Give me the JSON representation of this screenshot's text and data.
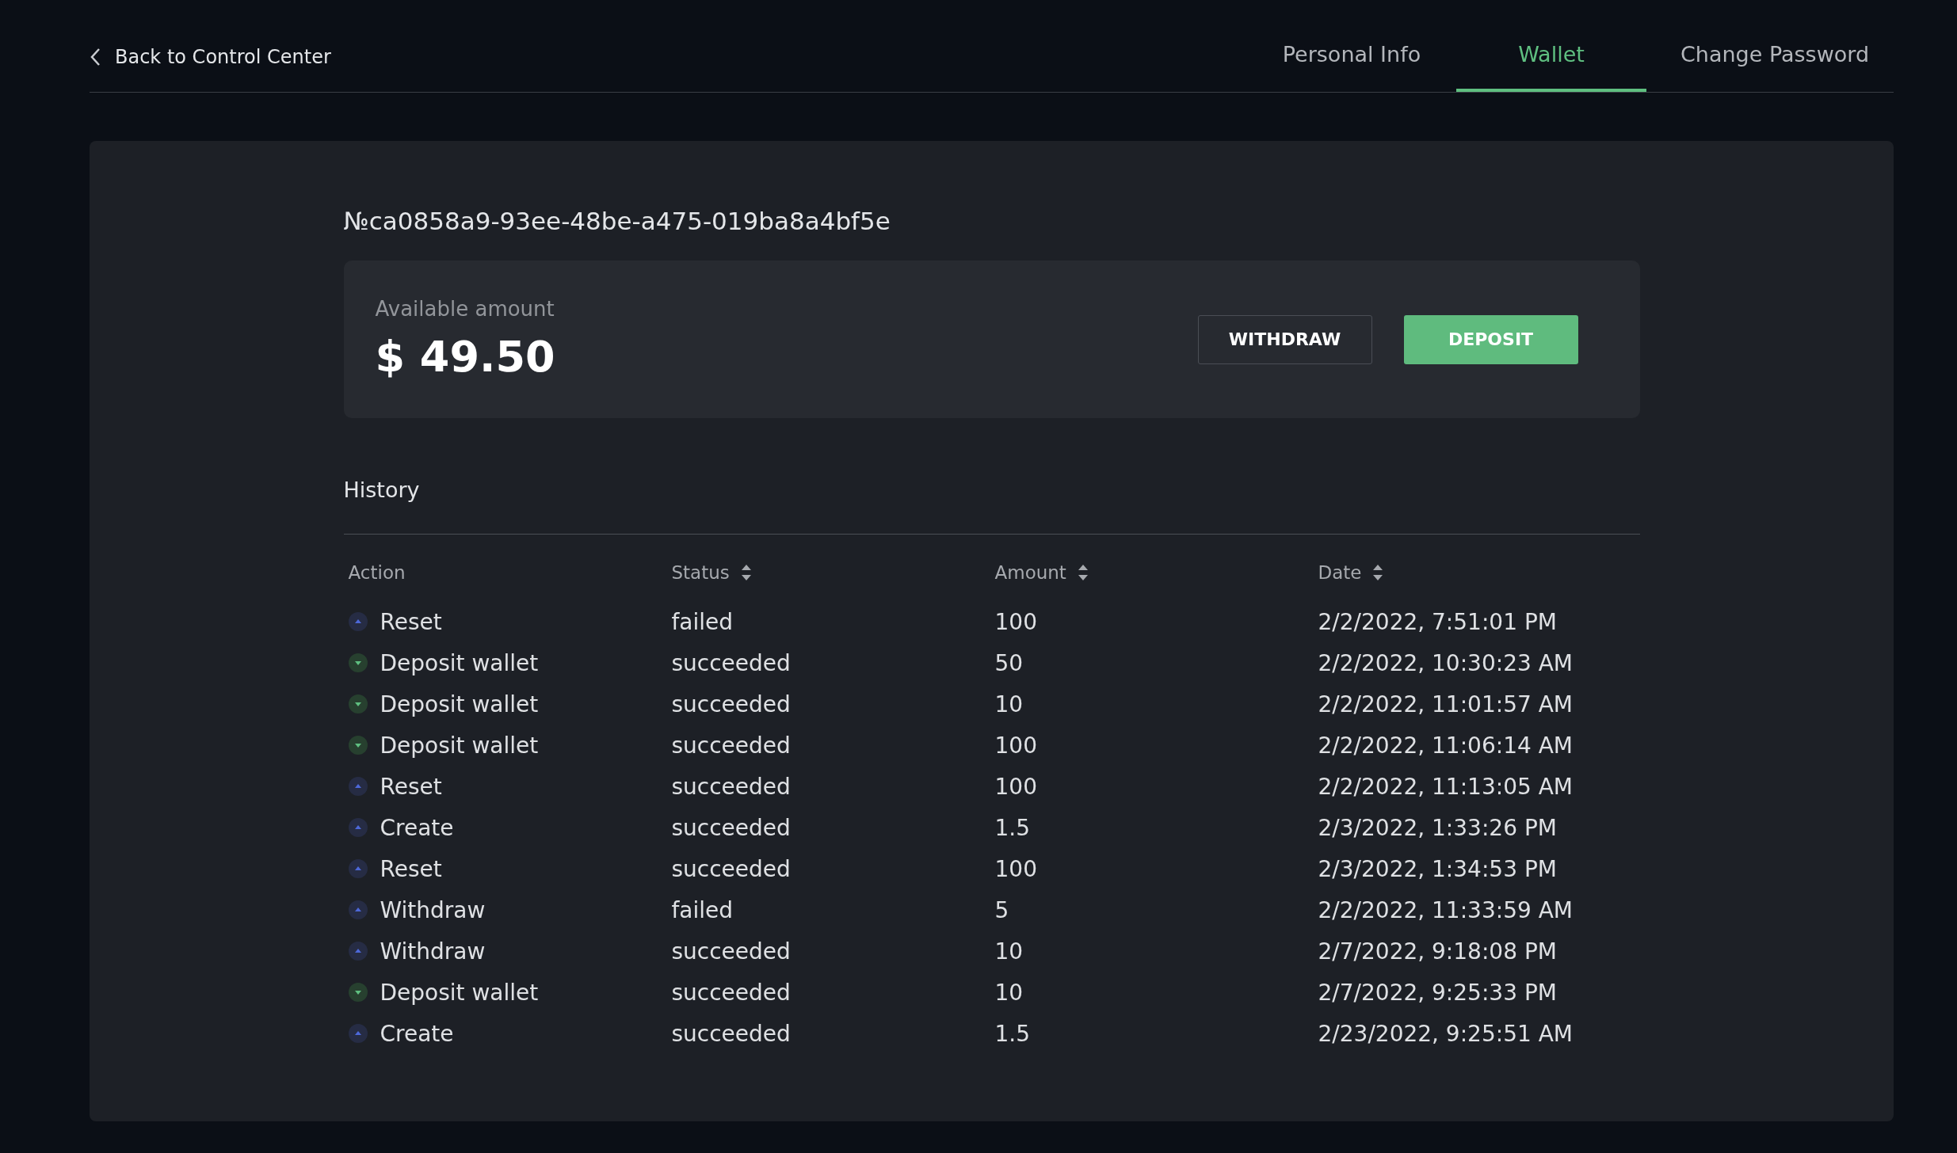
{
  "back_link": "Back to Control Center",
  "tabs": [
    {
      "label": "Personal Info",
      "selected": false
    },
    {
      "label": "Wallet",
      "selected": true
    },
    {
      "label": "Change Password",
      "selected": false
    }
  ],
  "wallet": {
    "id": "№ca0858a9-93ee-48be-a475-019ba8a4bf5e",
    "balance_label": "Available amount",
    "balance": "$ 49.50",
    "buttons": [
      {
        "label": "WITHDRAW",
        "kind": "outline"
      },
      {
        "label": "DEPOSIT",
        "kind": "primary"
      }
    ]
  },
  "history": {
    "title": "History",
    "columns": [
      {
        "label": "Action",
        "sortable": false
      },
      {
        "label": "Status",
        "sortable": true
      },
      {
        "label": "Amount",
        "sortable": true
      },
      {
        "label": "Date",
        "sortable": true
      }
    ],
    "rows": [
      {
        "kind": "outgoing",
        "action": "Reset",
        "status": "failed",
        "amount": "100",
        "date": "2/2/2022, 7:51:01 PM"
      },
      {
        "kind": "incoming",
        "action": "Deposit wallet",
        "status": "succeeded",
        "amount": "50",
        "date": "2/2/2022, 10:30:23 AM"
      },
      {
        "kind": "incoming",
        "action": "Deposit wallet",
        "status": "succeeded",
        "amount": "10",
        "date": "2/2/2022, 11:01:57 AM"
      },
      {
        "kind": "incoming",
        "action": "Deposit wallet",
        "status": "succeeded",
        "amount": "100",
        "date": "2/2/2022, 11:06:14 AM"
      },
      {
        "kind": "outgoing",
        "action": "Reset",
        "status": "succeeded",
        "amount": "100",
        "date": "2/2/2022, 11:13:05 AM"
      },
      {
        "kind": "outgoing",
        "action": "Create",
        "status": "succeeded",
        "amount": "1.5",
        "date": "2/3/2022, 1:33:26 PM"
      },
      {
        "kind": "outgoing",
        "action": "Reset",
        "status": "succeeded",
        "amount": "100",
        "date": "2/3/2022, 1:34:53 PM"
      },
      {
        "kind": "outgoing",
        "action": "Withdraw",
        "status": "failed",
        "amount": "5",
        "date": "2/2/2022, 11:33:59 AM"
      },
      {
        "kind": "outgoing",
        "action": "Withdraw",
        "status": "succeeded",
        "amount": "10",
        "date": "2/7/2022, 9:18:08 PM"
      },
      {
        "kind": "incoming",
        "action": "Deposit wallet",
        "status": "succeeded",
        "amount": "10",
        "date": "2/7/2022, 9:25:33 PM"
      },
      {
        "kind": "outgoing",
        "action": "Create",
        "status": "succeeded",
        "amount": "1.5",
        "date": "2/23/2022, 9:25:51 AM"
      }
    ]
  }
}
